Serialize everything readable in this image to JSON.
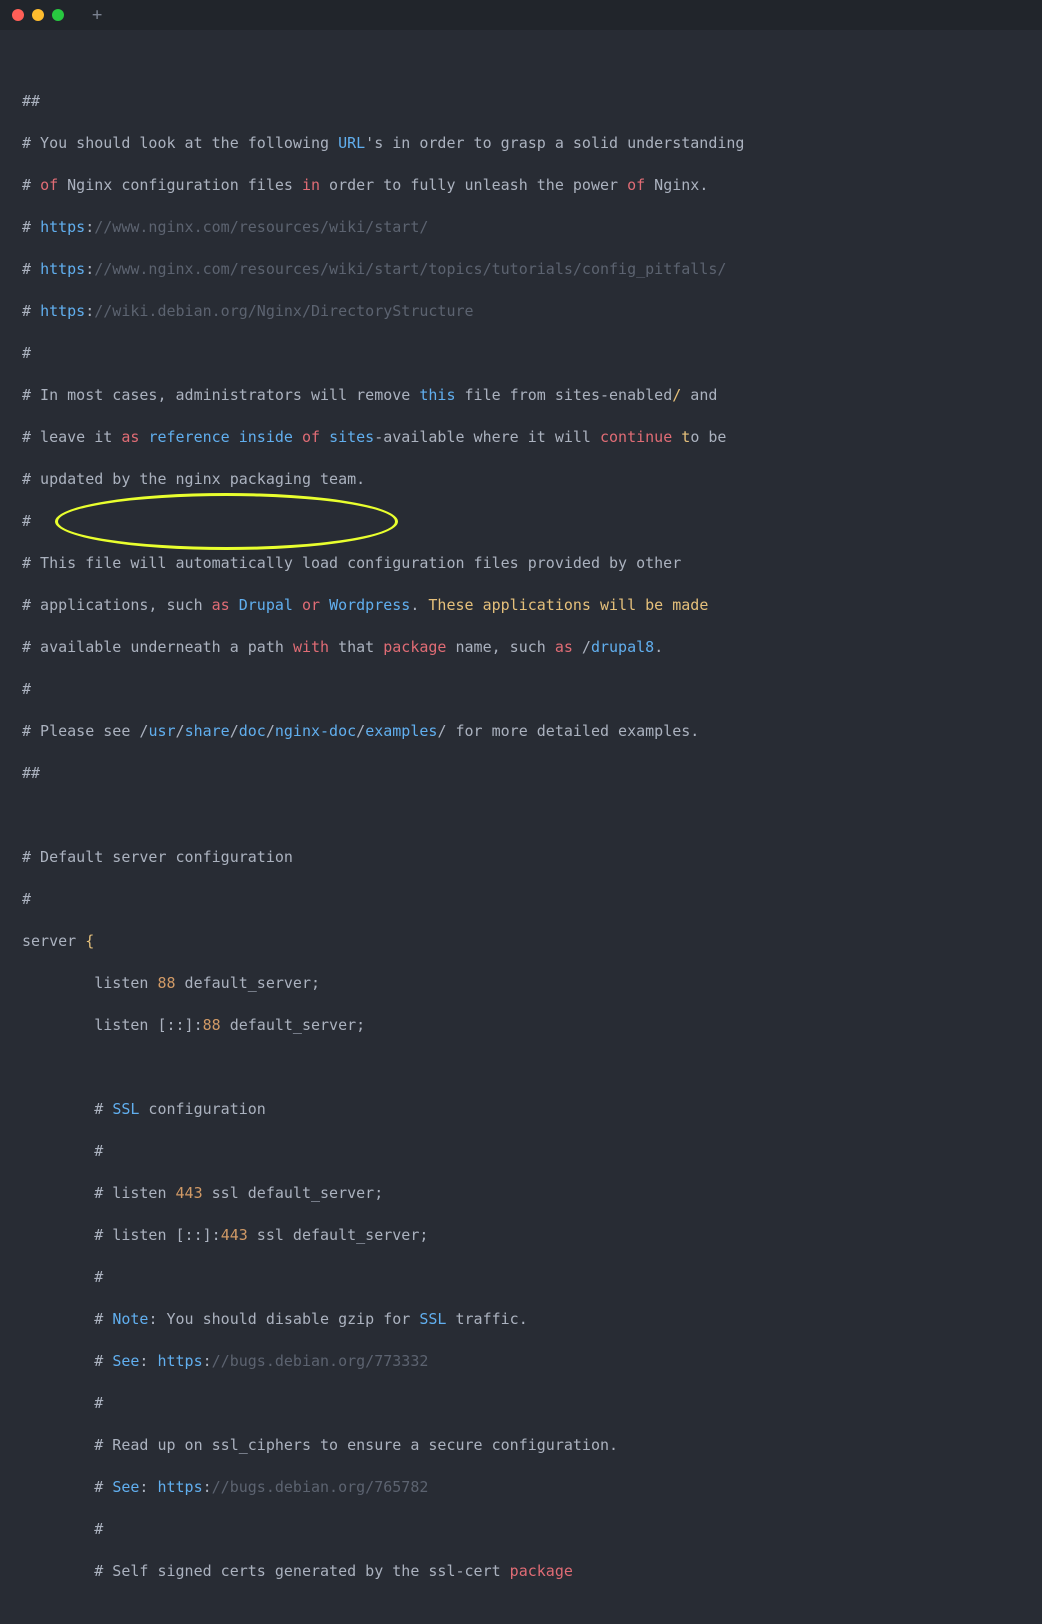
{
  "window": {
    "close": "close",
    "minimize": "minimize",
    "maximize": "maximize",
    "newtab": "+"
  },
  "code": {
    "hash2a": "##",
    "hash": "#",
    "sp": " ",
    "l2_you_should": "# You should look at the following ",
    "l2_url": "URL",
    "l2_rest": "'s in order to grasp a solid understanding",
    "l3_hash_of": "# ",
    "l3_of": "of",
    "l3_mid": " Nginx configuration files ",
    "l3_in": "in",
    "l3_mid2": " order to fully unleash the power ",
    "l3_of2": "of",
    "l3_end": " Nginx.",
    "l4_h": "# ",
    "l4_https": "https",
    "l4_colon": ":",
    "l4_url": "//www.nginx.com/resources/wiki/start/",
    "l5_url": "//www.nginx.com/resources/wiki/start/topics/tutorials/config_pitfalls/",
    "l6_url": "//wiki.debian.org/Nginx/DirectoryStructure",
    "l8_a": "# In most cases, administrators will remove ",
    "l8_this": "this",
    "l8_b": " file from sites-enabled",
    "l8_slash": "/",
    "l8_c": " and",
    "l9_a": "# leave it ",
    "l9_as": "as",
    "l9_sp": " ",
    "l9_ref": "reference",
    "l9_sp2": " ",
    "l9_inside": "inside",
    "l9_sp3": " ",
    "l9_of": "of",
    "l9_sp4": " ",
    "l9_sites": "sites",
    "l9_b": "-available where it will ",
    "l9_cont": "continue",
    "l9_sp5": " ",
    "l9_t": "t",
    "l9_c": "o be",
    "l10": "# updated by the nginx packaging team.",
    "l12": "# This file will automatically load configuration files provided by other",
    "l13_a": "# applications, such ",
    "l13_as": "as",
    "l13_sp": " ",
    "l13_dr": "Drupal",
    "l13_sp2": " ",
    "l13_or": "or",
    "l13_sp3": " ",
    "l13_wp": "Wordpress",
    "l13_b": ". ",
    "l13_these": "These",
    "l13_sp4": " ",
    "l13_apps": "applications",
    "l13_sp5": " ",
    "l13_will": "will",
    "l13_sp6": " ",
    "l13_be": "be",
    "l13_sp7": " ",
    "l13_made": "made",
    "l14_a": "# available underneath a path ",
    "l14_with": "with",
    "l14_b": " that ",
    "l14_pkg": "package",
    "l14_c": " name, such ",
    "l14_as": "as",
    "l14_d": " /",
    "l14_dr": "drupal8",
    "l14_e": ".",
    "l16_a": "# Please see /",
    "l16_usr": "usr",
    "l16_s": "/",
    "l16_share": "share",
    "l16_doc": "doc",
    "l16_ng": "nginx-doc",
    "l16_ex": "examples",
    "l16_b": "/ for more detailed examples.",
    "l20": "# Default server configuration",
    "l22_server": "server ",
    "l22_brace": "{",
    "indent": "        ",
    "l23_listen": "listen ",
    "l23_88": "88",
    "l23_ds": " default_server;",
    "l24_listen": "listen ",
    "l24_br": "[::]:",
    "l24_88": "88",
    "l24_ds": " default_server;",
    "l26_a": "# ",
    "l26_ssl": "SSL",
    "l26_b": " configuration",
    "l28_a": "# listen ",
    "l28_443": "443",
    "l28_b": " ssl default_server;",
    "l29_a": "# listen [::]:",
    "l29_443": "443",
    "l29_b": " ssl default_server;",
    "l31_a": "# ",
    "l31_note": "Note",
    "l31_b": ": You should disable gzip for ",
    "l31_ssl": "SSL",
    "l31_c": " traffic.",
    "l32_a": "# ",
    "l32_see": "See",
    "l32_b": ": ",
    "l32_https": "https",
    "l32_c": ":",
    "l32_url": "//bugs.debian.org/773332",
    "l34": "# Read up on ssl_ciphers to ensure a secure configuration.",
    "l35_url": "//bugs.debian.org/765782",
    "l37_a": "# Self signed certs generated by the ssl-cert ",
    "l37_pkg": "package"
  }
}
